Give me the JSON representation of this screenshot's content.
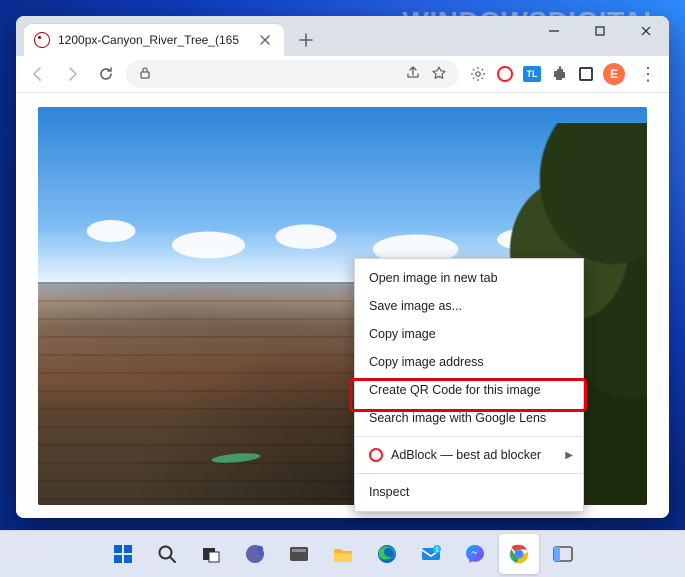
{
  "watermark": "WINDOWSDIGITAL",
  "window": {
    "tab_title": "1200px-Canyon_River_Tree_(165",
    "avatar_initial": "E",
    "tl_label": "TL"
  },
  "context_menu": {
    "items": [
      "Open image in new tab",
      "Save image as...",
      "Copy image",
      "Copy image address",
      "Create QR Code for this image",
      "Search image with Google Lens"
    ],
    "adblock_label": "AdBlock — best ad blocker",
    "inspect_label": "Inspect",
    "highlighted_index": 5
  },
  "colors": {
    "highlight": "#e3000f",
    "avatar_bg": "#ff7043",
    "chrome_tabstrip": "#dce1e7"
  }
}
